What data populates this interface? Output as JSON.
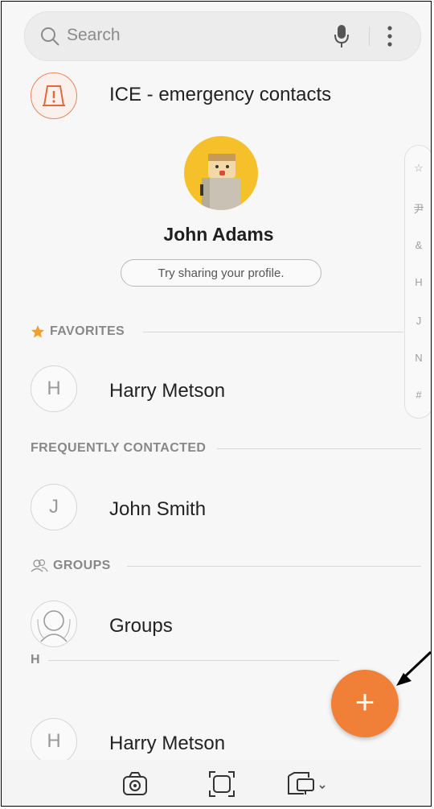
{
  "search": {
    "placeholder": "Search"
  },
  "ice": {
    "label": "ICE - emergency contacts"
  },
  "profile": {
    "name": "John Adams",
    "share_label": "Try sharing your profile."
  },
  "index_letters": [
    "☆",
    "尹",
    "&",
    "H",
    "J",
    "N",
    "#"
  ],
  "sections": {
    "favorites": "FAVORITES",
    "frequent": "FREQUENTLY CONTACTED",
    "groups": "GROUPS",
    "h": "H"
  },
  "contacts": {
    "favorite": {
      "initial": "H",
      "name": "Harry Metson"
    },
    "frequent": {
      "initial": "J",
      "name": "John Smith"
    },
    "groups": {
      "name": "Groups"
    },
    "h_list": {
      "initial": "H",
      "name": "Harry Metson"
    }
  },
  "fab": {
    "label": "+"
  },
  "colors": {
    "accent": "#f07f38",
    "ice": "#e8855f",
    "avatar_bg": "#f5c02a"
  },
  "icons": [
    "search-icon",
    "mic-icon",
    "more-icon",
    "warning-icon",
    "star-icon",
    "groups-icon",
    "plus-icon",
    "camera-icon",
    "scan-icon",
    "devices-icon"
  ]
}
